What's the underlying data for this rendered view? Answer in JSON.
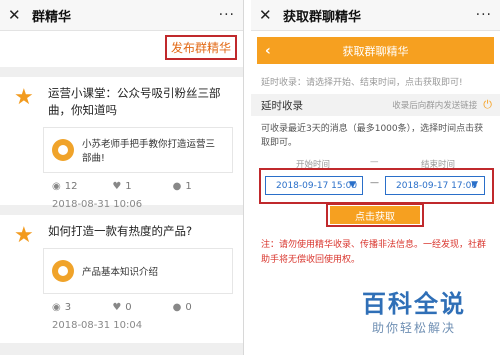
{
  "left": {
    "header": {
      "title": "群精华",
      "more": "···"
    },
    "publish_label": "发布群精华",
    "posts": [
      {
        "title": "运营小课堂：公众号吸引粉丝三部曲，你知道吗",
        "embed_text": "小苏老师手把手教你打造运营三部曲!",
        "views": "12",
        "likes": "1",
        "comments": "1",
        "date": "2018-08-31 10:06"
      },
      {
        "title": "如何打造一款有热度的产品?",
        "embed_text": "产品基本知识介绍",
        "views": "3",
        "likes": "0",
        "comments": "0",
        "date": "2018-08-31 10:04"
      }
    ]
  },
  "right": {
    "header": {
      "title": "获取群聊精华",
      "more": "···"
    },
    "page_title": "获取群聊精华",
    "hint": "延时收录：请选择开始、结束时间，点击获取即可!",
    "delay_label": "延时收录",
    "delay_right": "收录后向群内发送链接",
    "desc": "可收录最近3天的消息（最多1000条），选择时间点击获取即可。",
    "start_label": "开始时间",
    "end_label": "结束时间",
    "start_value": "2018-09-17 15:00",
    "end_value": "2018-09-17 17:00",
    "fetch_label": "点击获取",
    "warning": "注：请勿使用精华收录、传播非法信息。一经发现，社群助手将无偿收回使用权。",
    "watermark_title": "百科全说",
    "watermark_sub": "助你轻松解决"
  }
}
